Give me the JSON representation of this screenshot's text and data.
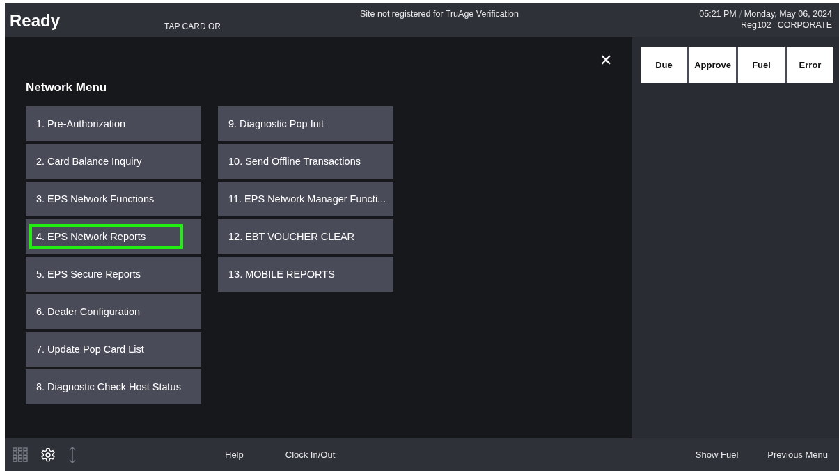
{
  "header": {
    "status": "Ready",
    "prompt": "TAP CARD OR",
    "notice": "Site not registered for TruAge Verification",
    "time": "05:21 PM",
    "date": "Monday, May 06, 2024",
    "register": "Reg102",
    "site": "CORPORATE"
  },
  "menu": {
    "title": "Network Menu",
    "close": "✕",
    "items": [
      {
        "label": "1. Pre-Authorization",
        "highlighted": false
      },
      {
        "label": "2. Card Balance Inquiry",
        "highlighted": false
      },
      {
        "label": "3. EPS Network Functions",
        "highlighted": false
      },
      {
        "label": "4. EPS Network Reports",
        "highlighted": true
      },
      {
        "label": "5. EPS Secure Reports",
        "highlighted": false
      },
      {
        "label": "6. Dealer Configuration",
        "highlighted": false
      },
      {
        "label": "7. Update Pop Card List",
        "highlighted": false
      },
      {
        "label": "8. Diagnostic Check Host Status",
        "highlighted": false
      },
      {
        "label": "9. Diagnostic Pop Init",
        "highlighted": false
      },
      {
        "label": "10. Send Offline Transactions",
        "highlighted": false
      },
      {
        "label": "11. EPS Network Manager Functi...",
        "highlighted": false
      },
      {
        "label": "12. EBT VOUCHER CLEAR",
        "highlighted": false
      },
      {
        "label": "13. MOBILE REPORTS",
        "highlighted": false
      }
    ]
  },
  "filters": [
    "Due",
    "Approve",
    "Fuel",
    "Error"
  ],
  "footer": {
    "left": [
      "Help",
      "Clock In/Out"
    ],
    "right": [
      "Show Fuel",
      "Previous Menu"
    ]
  }
}
